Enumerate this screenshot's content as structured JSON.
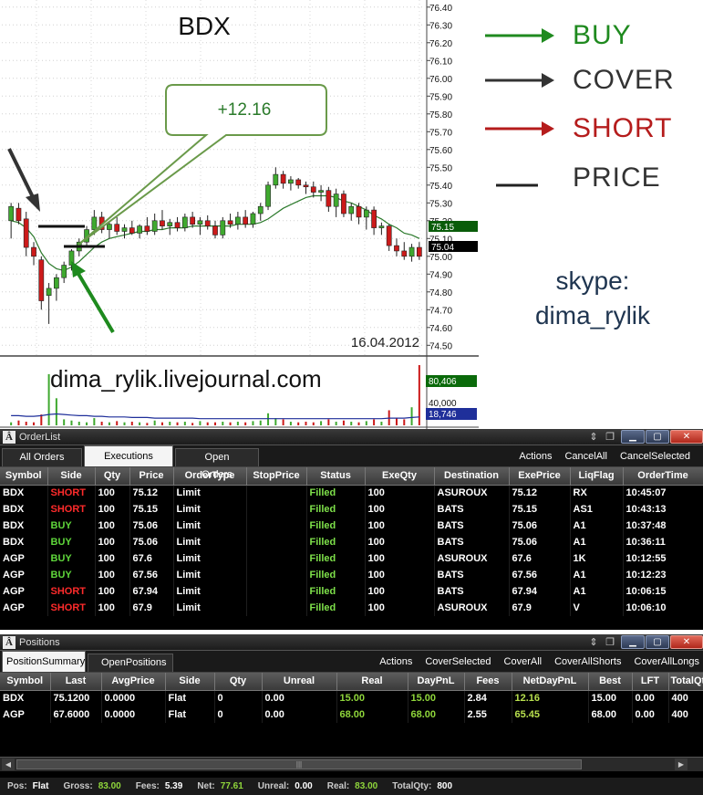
{
  "chart": {
    "symbol": "BDX",
    "date": "16.04.2012",
    "watermark": "dima_rylik.livejournal.com",
    "callout": "+12.16",
    "price_tag_upper": "75.15",
    "price_tag_lower": "75.04",
    "vol_tag_upper": "80,406",
    "vol_tag_mid": "40,000",
    "vol_tag_lower": "18,746",
    "colors": {
      "up": "#3fa92f",
      "down": "#cc1a1a",
      "ma": "#2c7a2c",
      "buy_arrow": "#1e8a1e",
      "cover_arrow": "#333333"
    }
  },
  "chart_data": {
    "type": "candlestick",
    "title": "BDX",
    "ylim": [
      74.44,
      76.44
    ],
    "yticks": [
      "76.40",
      "76.30",
      "76.20",
      "76.10",
      "76.00",
      "75.90",
      "75.80",
      "75.70",
      "75.60",
      "75.50",
      "75.40",
      "75.30",
      "75.20",
      "75.10",
      "75.00",
      "74.90",
      "74.80",
      "74.70",
      "74.60",
      "74.50"
    ],
    "candles": [
      {
        "o": 75.2,
        "h": 75.3,
        "l": 75.1,
        "c": 75.28
      },
      {
        "o": 75.27,
        "h": 75.3,
        "l": 75.18,
        "c": 75.2
      },
      {
        "o": 75.21,
        "h": 75.25,
        "l": 75.0,
        "c": 75.05
      },
      {
        "o": 75.05,
        "h": 75.08,
        "l": 74.95,
        "c": 75.0
      },
      {
        "o": 74.98,
        "h": 75.0,
        "l": 74.7,
        "c": 74.75
      },
      {
        "o": 74.78,
        "h": 74.85,
        "l": 74.62,
        "c": 74.82
      },
      {
        "o": 74.82,
        "h": 74.9,
        "l": 74.75,
        "c": 74.88
      },
      {
        "o": 74.88,
        "h": 74.97,
        "l": 74.85,
        "c": 74.95
      },
      {
        "o": 74.95,
        "h": 75.04,
        "l": 74.92,
        "c": 75.03
      },
      {
        "o": 75.03,
        "h": 75.1,
        "l": 75.0,
        "c": 75.08
      },
      {
        "o": 75.08,
        "h": 75.17,
        "l": 75.05,
        "c": 75.15
      },
      {
        "o": 75.15,
        "h": 75.26,
        "l": 75.12,
        "c": 75.22
      },
      {
        "o": 75.22,
        "h": 75.25,
        "l": 75.13,
        "c": 75.15
      },
      {
        "o": 75.15,
        "h": 75.2,
        "l": 75.1,
        "c": 75.18
      },
      {
        "o": 75.18,
        "h": 75.22,
        "l": 75.12,
        "c": 75.14
      },
      {
        "o": 75.14,
        "h": 75.18,
        "l": 75.1,
        "c": 75.16
      },
      {
        "o": 75.16,
        "h": 75.2,
        "l": 75.12,
        "c": 75.13
      },
      {
        "o": 75.13,
        "h": 75.18,
        "l": 75.1,
        "c": 75.17
      },
      {
        "o": 75.17,
        "h": 75.22,
        "l": 75.12,
        "c": 75.14
      },
      {
        "o": 75.14,
        "h": 75.24,
        "l": 75.12,
        "c": 75.2
      },
      {
        "o": 75.2,
        "h": 75.26,
        "l": 75.15,
        "c": 75.17
      },
      {
        "o": 75.17,
        "h": 75.21,
        "l": 75.12,
        "c": 75.19
      },
      {
        "o": 75.19,
        "h": 75.22,
        "l": 75.14,
        "c": 75.16
      },
      {
        "o": 75.16,
        "h": 75.24,
        "l": 75.14,
        "c": 75.22
      },
      {
        "o": 75.22,
        "h": 75.25,
        "l": 75.16,
        "c": 75.18
      },
      {
        "o": 75.18,
        "h": 75.22,
        "l": 75.12,
        "c": 75.2
      },
      {
        "o": 75.2,
        "h": 75.23,
        "l": 75.15,
        "c": 75.17
      },
      {
        "o": 75.17,
        "h": 75.2,
        "l": 75.1,
        "c": 75.12
      },
      {
        "o": 75.12,
        "h": 75.22,
        "l": 75.1,
        "c": 75.2
      },
      {
        "o": 75.2,
        "h": 75.24,
        "l": 75.16,
        "c": 75.18
      },
      {
        "o": 75.18,
        "h": 75.25,
        "l": 75.15,
        "c": 75.22
      },
      {
        "o": 75.22,
        "h": 75.26,
        "l": 75.16,
        "c": 75.18
      },
      {
        "o": 75.18,
        "h": 75.25,
        "l": 75.16,
        "c": 75.24
      },
      {
        "o": 75.24,
        "h": 75.3,
        "l": 75.2,
        "c": 75.28
      },
      {
        "o": 75.28,
        "h": 75.42,
        "l": 75.26,
        "c": 75.4
      },
      {
        "o": 75.4,
        "h": 75.5,
        "l": 75.38,
        "c": 75.46
      },
      {
        "o": 75.46,
        "h": 75.48,
        "l": 75.38,
        "c": 75.41
      },
      {
        "o": 75.41,
        "h": 75.45,
        "l": 75.37,
        "c": 75.43
      },
      {
        "o": 75.43,
        "h": 75.44,
        "l": 75.38,
        "c": 75.4
      },
      {
        "o": 75.4,
        "h": 75.42,
        "l": 75.35,
        "c": 75.39
      },
      {
        "o": 75.39,
        "h": 75.42,
        "l": 75.33,
        "c": 75.36
      },
      {
        "o": 75.36,
        "h": 75.4,
        "l": 75.31,
        "c": 75.37
      },
      {
        "o": 75.37,
        "h": 75.39,
        "l": 75.25,
        "c": 75.28
      },
      {
        "o": 75.28,
        "h": 75.38,
        "l": 75.22,
        "c": 75.35
      },
      {
        "o": 75.35,
        "h": 75.37,
        "l": 75.22,
        "c": 75.24
      },
      {
        "o": 75.24,
        "h": 75.3,
        "l": 75.2,
        "c": 75.28
      },
      {
        "o": 75.28,
        "h": 75.3,
        "l": 75.18,
        "c": 75.22
      },
      {
        "o": 75.22,
        "h": 75.28,
        "l": 75.15,
        "c": 75.26
      },
      {
        "o": 75.26,
        "h": 75.28,
        "l": 75.12,
        "c": 75.16
      },
      {
        "o": 75.16,
        "h": 75.19,
        "l": 75.12,
        "c": 75.17
      },
      {
        "o": 75.17,
        "h": 75.18,
        "l": 75.03,
        "c": 75.06
      },
      {
        "o": 75.06,
        "h": 75.1,
        "l": 75.0,
        "c": 75.03
      },
      {
        "o": 75.03,
        "h": 75.08,
        "l": 74.98,
        "c": 75.0
      },
      {
        "o": 75.0,
        "h": 75.07,
        "l": 74.97,
        "c": 75.05
      },
      {
        "o": 75.05,
        "h": 75.08,
        "l": 74.98,
        "c": 75.0
      }
    ],
    "ma": [
      75.2,
      75.19,
      75.16,
      75.11,
      75.02,
      74.96,
      74.93,
      74.92,
      74.94,
      74.97,
      75.01,
      75.05,
      75.08,
      75.1,
      75.11,
      75.12,
      75.13,
      75.14,
      75.14,
      75.15,
      75.15,
      75.16,
      75.16,
      75.16,
      75.17,
      75.17,
      75.17,
      75.17,
      75.17,
      75.17,
      75.18,
      75.18,
      75.18,
      75.19,
      75.21,
      75.24,
      75.27,
      75.29,
      75.31,
      75.33,
      75.34,
      75.34,
      75.34,
      75.33,
      75.31,
      75.3,
      75.28,
      75.26,
      75.23,
      75.21,
      75.18,
      75.16,
      75.13,
      75.12,
      75.1
    ],
    "volume": [
      0.05,
      0.08,
      0.06,
      0.05,
      0.18,
      0.85,
      0.45,
      0.1,
      0.08,
      0.06,
      0.05,
      0.12,
      0.06,
      0.05,
      0.07,
      0.05,
      0.06,
      0.05,
      0.04,
      0.08,
      0.05,
      0.06,
      0.05,
      0.06,
      0.04,
      0.07,
      0.05,
      0.05,
      0.06,
      0.05,
      0.06,
      0.05,
      0.07,
      0.08,
      0.2,
      0.12,
      0.1,
      0.06,
      0.05,
      0.06,
      0.05,
      0.07,
      0.1,
      0.06,
      0.08,
      0.06,
      0.05,
      0.07,
      0.1,
      0.06,
      0.25,
      0.12,
      0.1,
      0.3,
      1.0
    ],
    "vol_ma": [
      0.16,
      0.16,
      0.15,
      0.15,
      0.16,
      0.18,
      0.19,
      0.18,
      0.17,
      0.16,
      0.16,
      0.15,
      0.15,
      0.14,
      0.14,
      0.14,
      0.13,
      0.13,
      0.13,
      0.12,
      0.12,
      0.12,
      0.12,
      0.12,
      0.12,
      0.11,
      0.11,
      0.11,
      0.11,
      0.11,
      0.11,
      0.11,
      0.11,
      0.11,
      0.11,
      0.11,
      0.11,
      0.11,
      0.11,
      0.11,
      0.11,
      0.11,
      0.11,
      0.11,
      0.11,
      0.11,
      0.11,
      0.11,
      0.11,
      0.11,
      0.12,
      0.12,
      0.12,
      0.13,
      0.14
    ]
  },
  "legend": [
    {
      "label": "BUY",
      "color": "#1f8a1f"
    },
    {
      "label": "COVER",
      "color": "#333333"
    },
    {
      "label": "SHORT",
      "color": "#b51c1c"
    },
    {
      "label": "PRICE",
      "color": "#222222"
    }
  ],
  "skype": {
    "line1": "skype:",
    "line2": "dima_rylik"
  },
  "orderlist": {
    "title": "OrderList",
    "tabs": [
      "All Orders",
      "Executions",
      "Open Orders"
    ],
    "actions": [
      "Actions",
      "CancelAll",
      "CancelSelected"
    ],
    "columns": [
      "Symbol",
      "Side",
      "Qty",
      "Price",
      "OrderType",
      "StopPrice",
      "Status",
      "ExeQty",
      "Destination",
      "ExePrice",
      "LiqFlag",
      "OrderTime"
    ],
    "rows": [
      [
        "BDX",
        "SHORT",
        "100",
        "75.12",
        "Limit",
        "",
        "Filled",
        "100",
        "ASUROUX",
        "75.12",
        "RX",
        "10:45:07"
      ],
      [
        "BDX",
        "SHORT",
        "100",
        "75.15",
        "Limit",
        "",
        "Filled",
        "100",
        "BATS",
        "75.15",
        "AS1",
        "10:43:13"
      ],
      [
        "BDX",
        "BUY",
        "100",
        "75.06",
        "Limit",
        "",
        "Filled",
        "100",
        "BATS",
        "75.06",
        "A1",
        "10:37:48"
      ],
      [
        "BDX",
        "BUY",
        "100",
        "75.06",
        "Limit",
        "",
        "Filled",
        "100",
        "BATS",
        "75.06",
        "A1",
        "10:36:11"
      ],
      [
        "AGP",
        "BUY",
        "100",
        "67.6",
        "Limit",
        "",
        "Filled",
        "100",
        "ASUROUX",
        "67.6",
        "1K",
        "10:12:55"
      ],
      [
        "AGP",
        "BUY",
        "100",
        "67.56",
        "Limit",
        "",
        "Filled",
        "100",
        "BATS",
        "67.56",
        "A1",
        "10:12:23"
      ],
      [
        "AGP",
        "SHORT",
        "100",
        "67.94",
        "Limit",
        "",
        "Filled",
        "100",
        "BATS",
        "67.94",
        "A1",
        "10:06:15"
      ],
      [
        "AGP",
        "SHORT",
        "100",
        "67.9",
        "Limit",
        "",
        "Filled",
        "100",
        "ASUROUX",
        "67.9",
        "V",
        "10:06:10"
      ]
    ]
  },
  "positions": {
    "title": "Positions",
    "tabs": [
      "PositionSummary",
      "OpenPositions"
    ],
    "actions": [
      "Actions",
      "CoverSelected",
      "CoverAll",
      "CoverAllShorts",
      "CoverAllLongs"
    ],
    "columns": [
      "Symbol",
      "Last",
      "AvgPrice",
      "Side",
      "Qty",
      "Unreal",
      "Real",
      "DayPnL",
      "Fees",
      "NetDayPnL",
      "Best",
      "LFT",
      "TotalQt"
    ],
    "rows": [
      [
        "BDX",
        "75.1200",
        "0.0000",
        "Flat",
        "0",
        "0.00",
        "15.00",
        "15.00",
        "2.84",
        "12.16",
        "15.00",
        "0.00",
        "400"
      ],
      [
        "AGP",
        "67.6000",
        "0.0000",
        "Flat",
        "0",
        "0.00",
        "68.00",
        "68.00",
        "2.55",
        "65.45",
        "68.00",
        "0.00",
        "400"
      ]
    ]
  },
  "status": {
    "pos_label": "Pos:",
    "pos": "Flat",
    "gross_label": "Gross:",
    "gross": "83.00",
    "fees_label": "Fees:",
    "fees": "5.39",
    "net_label": "Net:",
    "net": "77.61",
    "unreal_label": "Unreal:",
    "unreal": "0.00",
    "real_label": "Real:",
    "real": "83.00",
    "totalqty_label": "TotalQty:",
    "totalqty": "800"
  }
}
